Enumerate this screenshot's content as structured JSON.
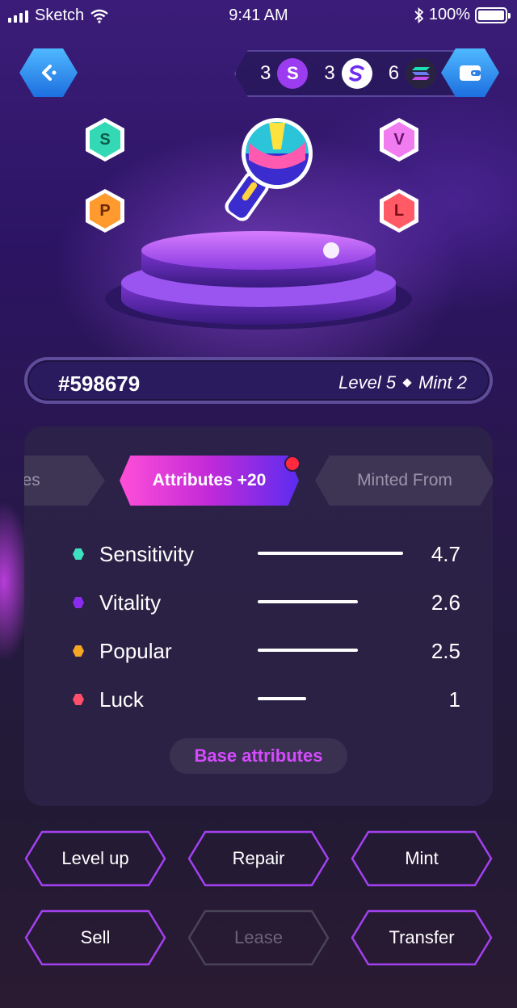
{
  "status_bar": {
    "carrier": "Sketch",
    "time": "9:41 AM",
    "battery": "100%"
  },
  "currencies": [
    {
      "amount": "3",
      "icon": "s-token-icon",
      "color": "#9b3cf0"
    },
    {
      "amount": "3",
      "icon": "swap-token-icon",
      "color": "#ffffff"
    },
    {
      "amount": "6",
      "icon": "solana-icon",
      "color": "#2a2340"
    }
  ],
  "attribute_badges": {
    "s": "S",
    "p": "P",
    "v": "V",
    "l": "L"
  },
  "item": {
    "id": "#598679",
    "level": "Level 5",
    "mint": "Mint 2"
  },
  "tabs": {
    "left_partial": "utes",
    "active": "Attributes +20",
    "right": "Minted From"
  },
  "attributes": [
    {
      "name": "Sensitivity",
      "value": "4.7",
      "color": "#3fe0c0",
      "fraction": 1.0
    },
    {
      "name": "Vitality",
      "value": "2.6",
      "color": "#8a2cf0",
      "fraction": 0.55
    },
    {
      "name": "Popular",
      "value": "2.5",
      "color": "#f5a623",
      "fraction": 0.53
    },
    {
      "name": "Luck",
      "value": "1",
      "color": "#ff4f6a",
      "fraction": 0.21
    }
  ],
  "base_attributes_label": "Base attributes",
  "actions": [
    {
      "label": "Level up",
      "enabled": true
    },
    {
      "label": "Repair",
      "enabled": true
    },
    {
      "label": "Mint",
      "enabled": true
    },
    {
      "label": "Sell",
      "enabled": true
    },
    {
      "label": "Lease",
      "enabled": false
    },
    {
      "label": "Transfer",
      "enabled": true
    }
  ]
}
